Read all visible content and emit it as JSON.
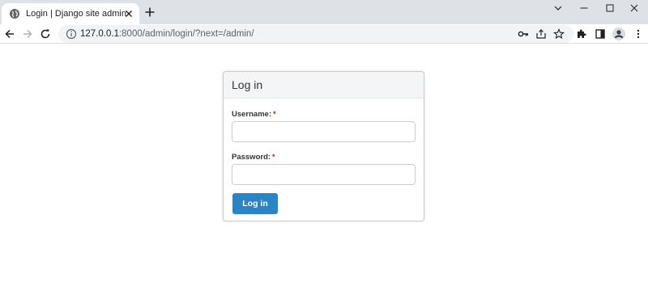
{
  "browser": {
    "tab": {
      "title": "Login | Django site admin",
      "favicon": "globe-icon"
    },
    "address": {
      "host": "127.0.0.1",
      "rest": ":8000/admin/login/?next=/admin/"
    },
    "icons": [
      "back-arrow-icon",
      "forward-arrow-icon",
      "reload-icon",
      "info-icon",
      "key-icon",
      "share-icon",
      "star-icon",
      "extensions-icon",
      "side-panel-icon",
      "profile-icon",
      "menu-icon",
      "minimize-icon",
      "maximize-icon",
      "close-icon",
      "new-tab-icon",
      "tab-search-icon"
    ]
  },
  "login": {
    "title": "Log in",
    "username_label": "Username:",
    "password_label": "Password:",
    "required_mark": "*",
    "username_value": "",
    "password_value": "",
    "submit_label": "Log in"
  },
  "colors": {
    "accent": "#2a84c6",
    "required": "#ba2121",
    "header_bg": "#f4f5f6",
    "tabstrip_bg": "#dee1e6"
  }
}
